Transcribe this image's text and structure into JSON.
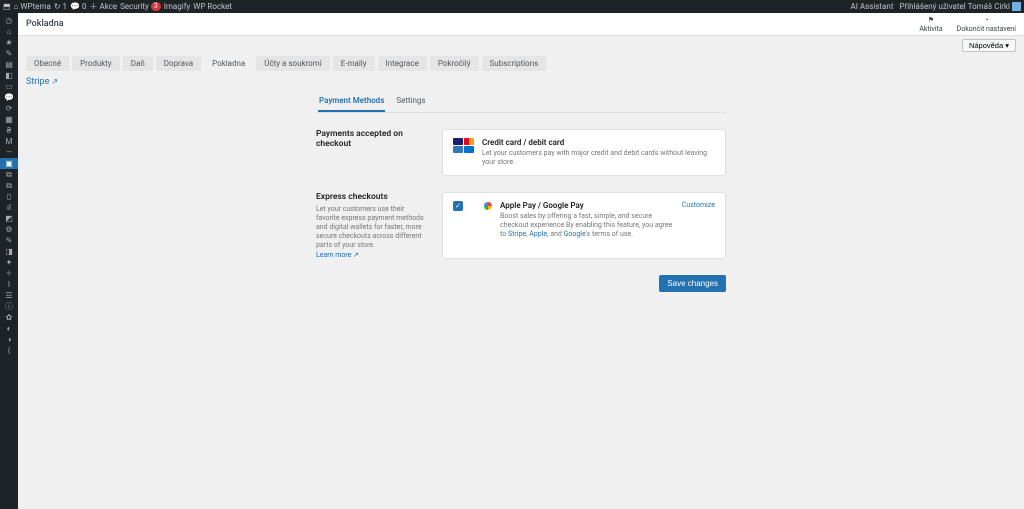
{
  "adminbar": {
    "left": [
      {
        "icon": "⬒",
        "label": ""
      },
      {
        "icon": "⌂",
        "label": "WPtema"
      },
      {
        "icon": "↻",
        "label": "1"
      },
      {
        "icon": "💬",
        "label": "0"
      },
      {
        "icon": "＋",
        "label": "Akce"
      },
      {
        "icon": "",
        "label": "Security"
      },
      {
        "icon": "",
        "label": "Imagify"
      },
      {
        "icon": "",
        "label": "WP Rocket"
      }
    ],
    "security_badge": "3",
    "right_ai": "AI Assistant",
    "right_user_pre": "Přihlášený uživatel ",
    "right_user": "Tomáš Cirkl"
  },
  "header": {
    "title": "Pokladna",
    "activity": "Aktivita",
    "finish": "Dokončit nastavení"
  },
  "help": "Nápověda ▾",
  "wc_tabs": [
    "Obecné",
    "Produkty",
    "Daň",
    "Doprava",
    "Pokladna",
    "Účty a soukromí",
    "E-maily",
    "Integrace",
    "Pokročilý",
    "Subscriptions"
  ],
  "wc_active": "Pokladna",
  "stripe_label": "Stripe",
  "subtabs": {
    "pm": "Payment Methods",
    "settings": "Settings"
  },
  "section1": {
    "title": "Payments accepted on checkout",
    "card_title": "Credit card / debit card",
    "card_desc": "Let your customers pay with major credit and debit cards without leaving your store."
  },
  "section2": {
    "title": "Express checkouts",
    "desc": "Let your customers use their favorite express payment methods and digital wallets for faster, more secure checkouts across different parts of your store.",
    "learn": "Learn more",
    "card_title": "Apple Pay / Google Pay",
    "card_desc1": "Boost sales by offering a fast, simple, and secure checkout experience.By enabling this feature, you agree to ",
    "stripe": "Stripe",
    "apple": "Apple",
    "and": ", and ",
    "google": "Google",
    "desc_end": "'s terms of use.",
    "customize": "Customize"
  },
  "save": "Save changes",
  "sidebar_icons": [
    "◷",
    "⌂",
    "★",
    "✎",
    "▤",
    "◧",
    "▭",
    "💬",
    "⟳",
    "▦",
    "₴",
    "M",
    "—",
    "▣",
    "⧉",
    "⧉",
    "▯",
    "ıl",
    "◩",
    "⚙",
    "✎",
    "◨",
    "✦",
    "✧",
    "⌇",
    "☰",
    "ⓘ",
    "✿",
    "◐",
    "◑",
    "⟨"
  ]
}
